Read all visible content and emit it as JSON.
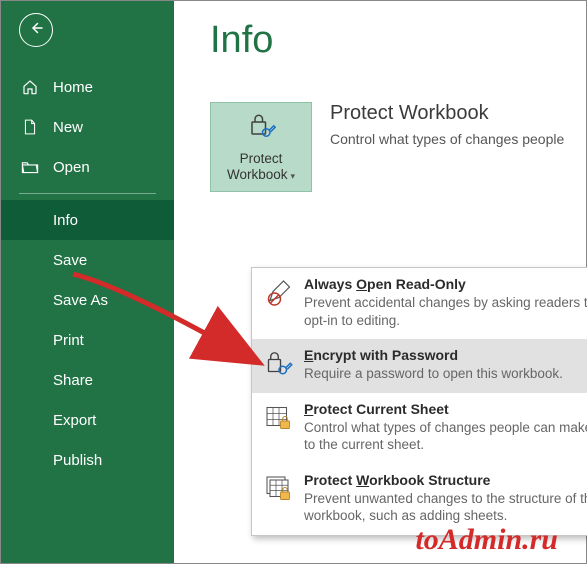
{
  "page_title": "Info",
  "sidebar": {
    "items": [
      {
        "label": "Home"
      },
      {
        "label": "New"
      },
      {
        "label": "Open"
      },
      {
        "label": "Info",
        "selected": true
      },
      {
        "label": "Save"
      },
      {
        "label": "Save As"
      },
      {
        "label": "Print"
      },
      {
        "label": "Share"
      },
      {
        "label": "Export"
      },
      {
        "label": "Publish"
      }
    ]
  },
  "protect_button": {
    "line1": "Protect",
    "line2": "Workbook"
  },
  "section": {
    "heading": "Protect Workbook",
    "description": "Control what types of changes people"
  },
  "menu": [
    {
      "title_pre": "Always ",
      "accel": "O",
      "title_post": "pen Read-Only",
      "desc": "Prevent accidental changes by asking readers to opt-in to editing."
    },
    {
      "title_pre": "",
      "accel": "E",
      "title_post": "ncrypt with Password",
      "desc": "Require a password to open this workbook."
    },
    {
      "title_pre": "",
      "accel": "P",
      "title_post": "rotect Current Sheet",
      "desc": "Control what types of changes people can make to the current sheet."
    },
    {
      "title_pre": "Protect ",
      "accel": "W",
      "title_post": "orkbook Structure",
      "desc": "Prevent unwanted changes to the structure of the workbook, such as adding sheets."
    }
  ],
  "watermark": "toAdmin.ru"
}
